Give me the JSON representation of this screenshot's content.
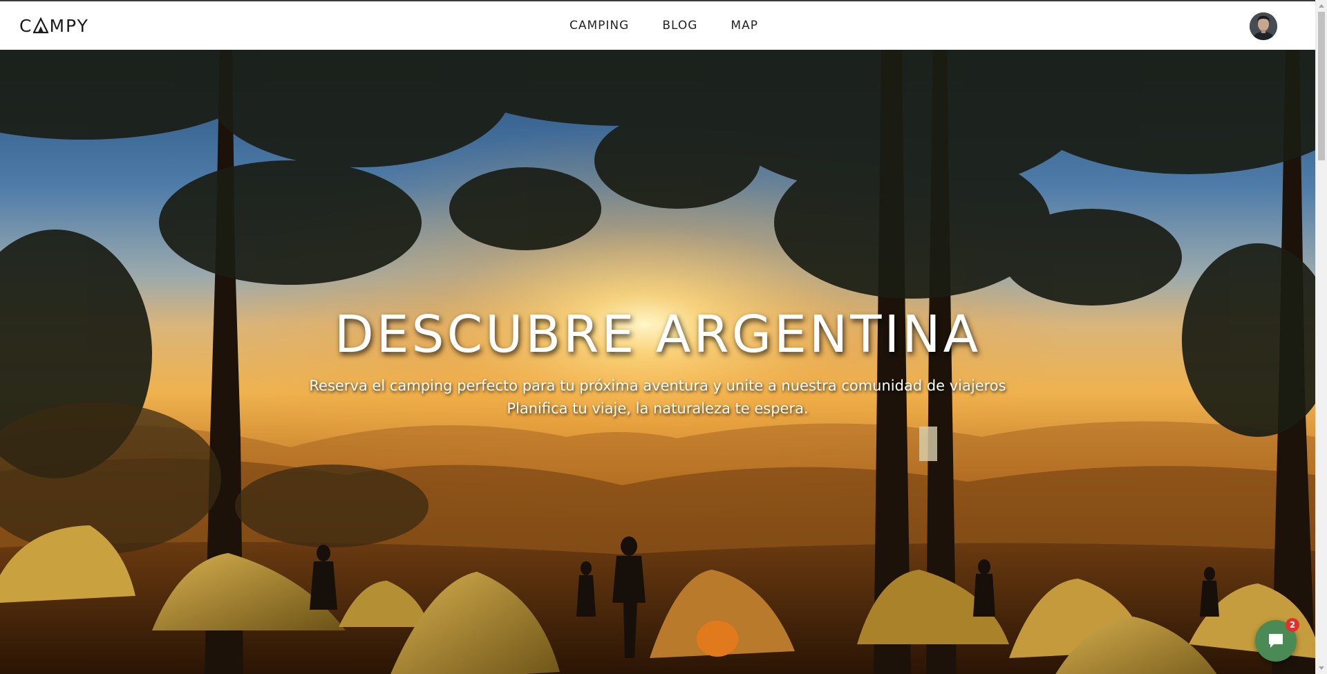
{
  "header": {
    "logo_text_pre": "C",
    "logo_text_post": "MPY",
    "nav": [
      {
        "label": "CAMPING"
      },
      {
        "label": "BLOG"
      },
      {
        "label": "MAP"
      }
    ]
  },
  "hero": {
    "title": "DESCUBRE ARGENTINA",
    "subtitle_line1": "Reserva el camping perfecto para tu próxima aventura y unite a nuestra comunidad de viajeros",
    "subtitle_line2": "Planifica tu viaje, la naturaleza te espera."
  },
  "chat": {
    "icon": "chat-bubble-icon",
    "badge_count": "2",
    "color": "#4a8a55",
    "badge_color": "#e0312e"
  },
  "icons": {
    "avatar": "user-avatar",
    "logo_a": "tent-triangle-icon"
  }
}
